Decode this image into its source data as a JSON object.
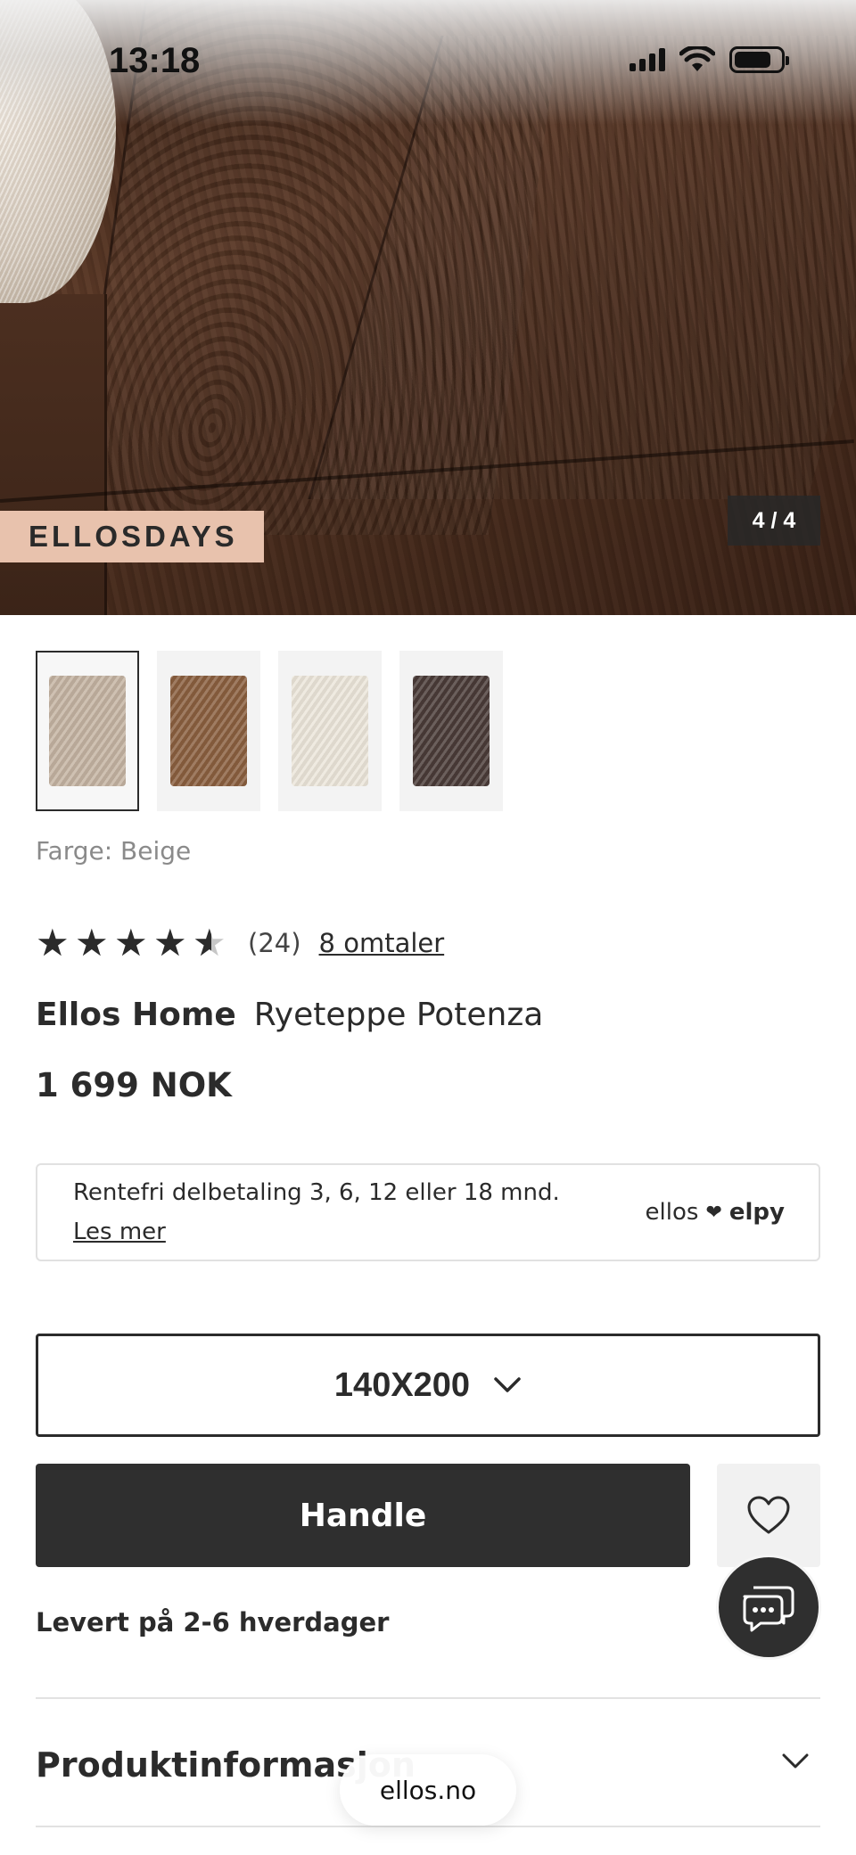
{
  "status_bar": {
    "time": "13:18"
  },
  "hero": {
    "promo_badge": "ELLOSDAYS",
    "image_counter": "4 / 4"
  },
  "thumbnails": [
    {
      "color": "#c4b3a1",
      "selected": true
    },
    {
      "color": "#8a5f3f",
      "selected": false
    },
    {
      "color": "#ece6da",
      "selected": false
    },
    {
      "color": "#4a3c38",
      "selected": false
    }
  ],
  "product": {
    "color_label": "Farge: Beige",
    "rating_value": 4.5,
    "rating_count": "(24)",
    "reviews_link": "8 omtaler",
    "brand": "Ellos Home",
    "name": "Ryeteppe Potenza",
    "price": "1 699 NOK"
  },
  "financing": {
    "text": "Rentefri delbetaling 3, 6, 12 eller 18 mnd.",
    "link": "Les mer",
    "logo_left": "ellos",
    "logo_right": "elpy"
  },
  "size_select": {
    "value": "140X200"
  },
  "actions": {
    "buy_label": "Handle"
  },
  "delivery": "Levert på 2-6 hverdager",
  "accordion": {
    "title": "Produktinformasjon"
  },
  "browser": {
    "url": "ellos.no"
  },
  "colors": {
    "primary_dark": "#2f2f2f",
    "promo": "#e8c2ad"
  },
  "icons": [
    "signal-icon",
    "wifi-icon",
    "battery-icon",
    "chevron-down-icon",
    "heart-icon",
    "chat-icon"
  ]
}
